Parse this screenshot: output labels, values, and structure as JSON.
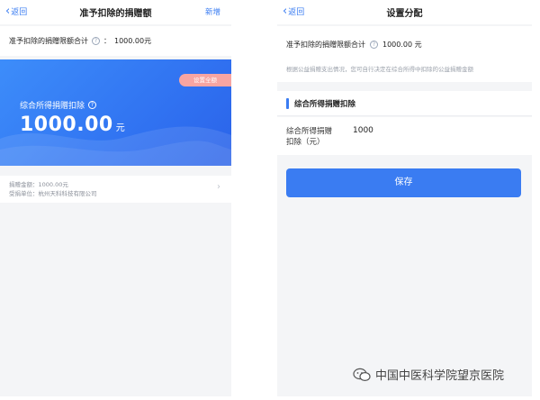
{
  "left": {
    "nav": {
      "back_label": "返回",
      "title": "准予扣除的捐赠额",
      "action_label": "新增"
    },
    "total": {
      "label": "准予扣除的捐赠限额合计",
      "colon": "：",
      "value": "1000.00元"
    },
    "card": {
      "set_button": "设置全额",
      "label": "综合所得捐赠扣除",
      "amount": "1000.00",
      "unit": "元"
    },
    "detail": {
      "line1": "捐赠金额：1000.00元",
      "line2": "受捐单位：杭州天科科技有限公司"
    }
  },
  "right": {
    "nav": {
      "back_label": "返回",
      "title": "设置分配"
    },
    "total": {
      "label": "准予扣除的捐赠限额合计",
      "value": "1000.00 元"
    },
    "note": "根据公益捐赠支出情况，您可自行决定在综合所得中扣除的公益捐赠金额",
    "section_title": "综合所得捐赠扣除",
    "form": {
      "label": "综合所得捐赠扣除（元）",
      "value": "1000"
    },
    "save_label": "保存"
  },
  "watermark": {
    "text": "中国中医科学院望京医院"
  },
  "colors": {
    "accent": "#3a7cf2",
    "set_button": "#f7a5a2"
  },
  "icons": {
    "back": "chevron-left-icon",
    "help": "question-circle-icon",
    "detail_arrow": "chevron-right-icon",
    "watermark": "wechat-icon"
  }
}
